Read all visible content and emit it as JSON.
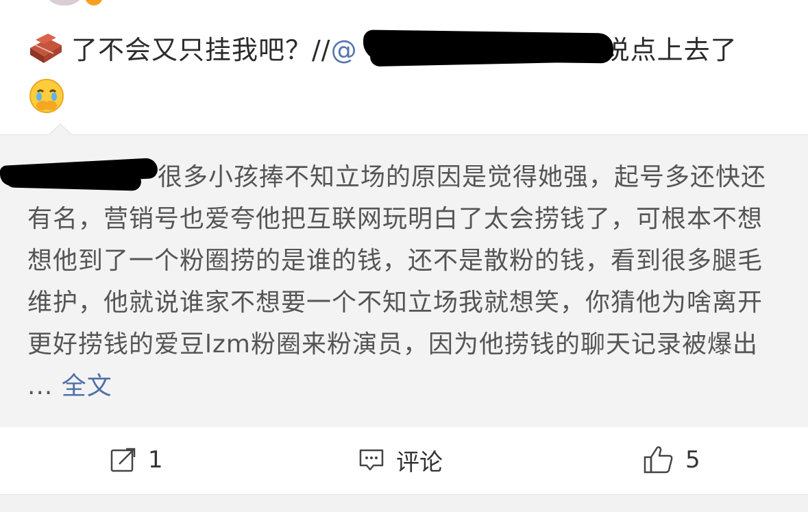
{
  "post": {
    "emoji_brick": "brick-emoji",
    "text_before_mention": "了不会又只挂我吧？//",
    "mention_visible": "@",
    "text_after_mention": "全说点上去了",
    "emoji_cry": "crying-covering-mouth-emoji"
  },
  "quote": {
    "user_visible": "",
    "body": "很多小孩捧不知立场的原因是觉得她强，起号多还快还有名，营销号也爱夸他把互联网玩明白了太会捞钱了，可根本不想想他到了一个粉圈捞的是谁的钱，还不是散粉的钱，看到很多腿毛维护，他就说谁家不想要一个不知立场我就想笑，你猜他为啥离开更好捞钱的爱豆lzm粉圈来粉演员，因为他捞钱的聊天记录被爆出 ...",
    "full_text_link": "全文"
  },
  "actions": {
    "repost_count": "1",
    "comment_label": "评论",
    "like_count": "5"
  },
  "colors": {
    "link_blue": "#4d71a8",
    "quote_bg": "#f3f3f3",
    "text_dark": "#2b2b2b"
  }
}
